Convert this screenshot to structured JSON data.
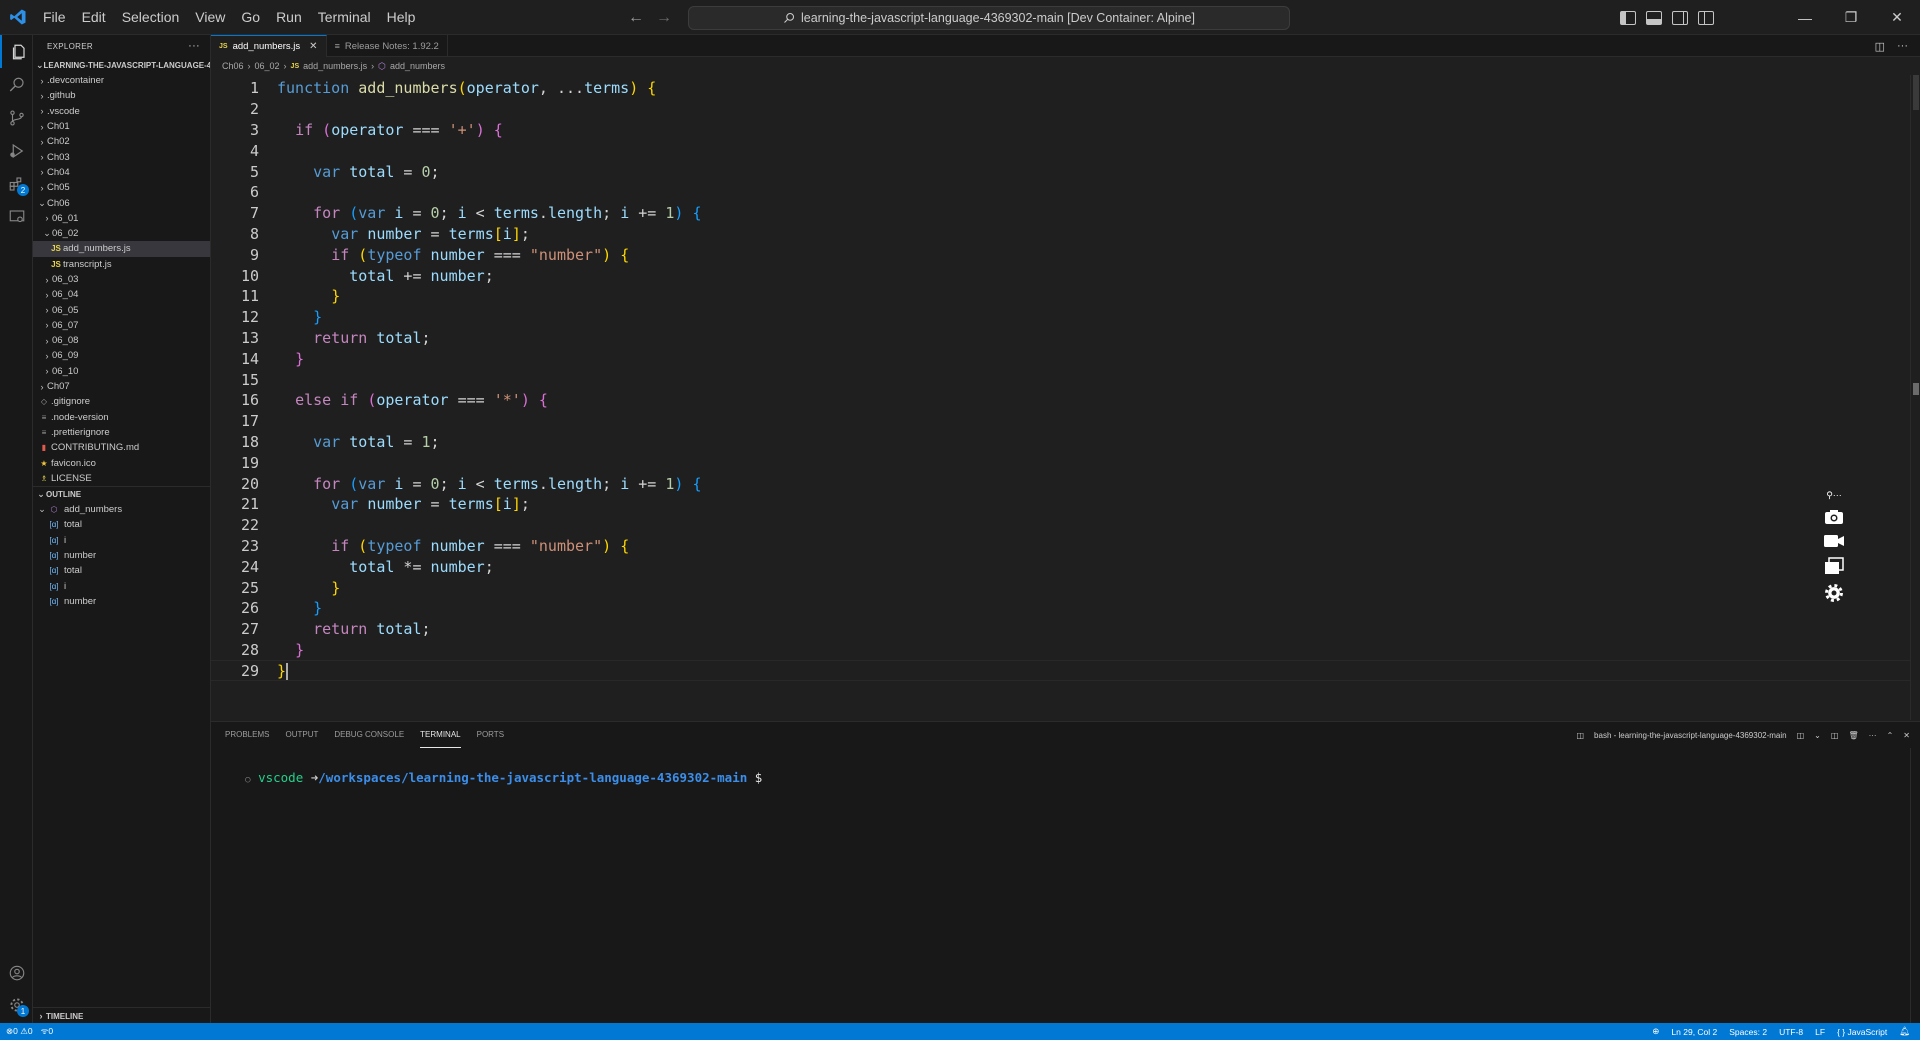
{
  "menu": [
    "File",
    "Edit",
    "Selection",
    "View",
    "Go",
    "Run",
    "Terminal",
    "Help"
  ],
  "command_center": "learning-the-javascript-language-4369302-main [Dev Container: Alpine]",
  "explorer": {
    "header": "EXPLORER",
    "root": "LEARNING-THE-JAVASCRIPT-LANGUAGE-4...",
    "items": [
      {
        "label": ".devcontainer",
        "indent": 0,
        "kind": "folder",
        "open": false
      },
      {
        "label": ".github",
        "indent": 0,
        "kind": "folder",
        "open": false
      },
      {
        "label": ".vscode",
        "indent": 0,
        "kind": "folder",
        "open": false
      },
      {
        "label": "Ch01",
        "indent": 0,
        "kind": "folder",
        "open": false
      },
      {
        "label": "Ch02",
        "indent": 0,
        "kind": "folder",
        "open": false
      },
      {
        "label": "Ch03",
        "indent": 0,
        "kind": "folder",
        "open": false
      },
      {
        "label": "Ch04",
        "indent": 0,
        "kind": "folder",
        "open": false
      },
      {
        "label": "Ch05",
        "indent": 0,
        "kind": "folder",
        "open": false
      },
      {
        "label": "Ch06",
        "indent": 0,
        "kind": "folder",
        "open": true
      },
      {
        "label": "06_01",
        "indent": 1,
        "kind": "folder",
        "open": false
      },
      {
        "label": "06_02",
        "indent": 1,
        "kind": "folder",
        "open": true
      },
      {
        "label": "add_numbers.js",
        "indent": 2,
        "kind": "js",
        "selected": true
      },
      {
        "label": "transcript.js",
        "indent": 2,
        "kind": "js"
      },
      {
        "label": "06_03",
        "indent": 1,
        "kind": "folder",
        "open": false
      },
      {
        "label": "06_04",
        "indent": 1,
        "kind": "folder",
        "open": false
      },
      {
        "label": "06_05",
        "indent": 1,
        "kind": "folder",
        "open": false
      },
      {
        "label": "06_07",
        "indent": 1,
        "kind": "folder",
        "open": false
      },
      {
        "label": "06_08",
        "indent": 1,
        "kind": "folder",
        "open": false
      },
      {
        "label": "06_09",
        "indent": 1,
        "kind": "folder",
        "open": false
      },
      {
        "label": "06_10",
        "indent": 1,
        "kind": "folder",
        "open": false
      },
      {
        "label": "Ch07",
        "indent": 0,
        "kind": "folder",
        "open": false
      },
      {
        "label": ".gitignore",
        "indent": 0,
        "kind": "git"
      },
      {
        "label": ".node-version",
        "indent": 0,
        "kind": "text"
      },
      {
        "label": ".prettierignore",
        "indent": 0,
        "kind": "text"
      },
      {
        "label": "CONTRIBUTING.md",
        "indent": 0,
        "kind": "md"
      },
      {
        "label": "favicon.ico",
        "indent": 0,
        "kind": "ico"
      },
      {
        "label": "LICENSE",
        "indent": 0,
        "kind": "license"
      }
    ]
  },
  "outline": {
    "header": "OUTLINE",
    "items": [
      {
        "label": "add_numbers",
        "kind": "function"
      },
      {
        "label": "total",
        "kind": "variable"
      },
      {
        "label": "i",
        "kind": "variable"
      },
      {
        "label": "number",
        "kind": "variable"
      },
      {
        "label": "total",
        "kind": "variable"
      },
      {
        "label": "i",
        "kind": "variable"
      },
      {
        "label": "number",
        "kind": "variable"
      }
    ]
  },
  "timeline": "TIMELINE",
  "tabs": [
    {
      "label": "add_numbers.js",
      "icon": "JS",
      "active": true
    },
    {
      "label": "Release Notes: 1.92.2",
      "icon": "≡",
      "active": false
    }
  ],
  "breadcrumbs": [
    "Ch06",
    "06_02",
    "add_numbers.js",
    "add_numbers"
  ],
  "code": [
    [
      [
        "kw",
        "function"
      ],
      [
        "def",
        " "
      ],
      [
        "fn",
        "add_numbers"
      ],
      [
        "b1",
        "("
      ],
      [
        "var",
        "operator"
      ],
      [
        "def",
        ", ..."
      ],
      [
        "var",
        "terms"
      ],
      [
        "b1",
        ")"
      ],
      [
        "def",
        " "
      ],
      [
        "b1",
        "{"
      ]
    ],
    [],
    [
      [
        "def",
        "  "
      ],
      [
        "kw2",
        "if"
      ],
      [
        "def",
        " "
      ],
      [
        "b2",
        "("
      ],
      [
        "var",
        "operator"
      ],
      [
        "def",
        " === "
      ],
      [
        "str",
        "'+'"
      ],
      [
        "b2",
        ")"
      ],
      [
        "def",
        " "
      ],
      [
        "b2",
        "{"
      ]
    ],
    [],
    [
      [
        "def",
        "    "
      ],
      [
        "kw",
        "var"
      ],
      [
        "def",
        " "
      ],
      [
        "var",
        "total"
      ],
      [
        "def",
        " = "
      ],
      [
        "num",
        "0"
      ],
      [
        "def",
        ";"
      ]
    ],
    [],
    [
      [
        "def",
        "    "
      ],
      [
        "kw2",
        "for"
      ],
      [
        "def",
        " "
      ],
      [
        "b3",
        "("
      ],
      [
        "kw",
        "var"
      ],
      [
        "def",
        " "
      ],
      [
        "var",
        "i"
      ],
      [
        "def",
        " = "
      ],
      [
        "num",
        "0"
      ],
      [
        "def",
        "; "
      ],
      [
        "var",
        "i"
      ],
      [
        "def",
        " < "
      ],
      [
        "var",
        "terms"
      ],
      [
        "def",
        "."
      ],
      [
        "var",
        "length"
      ],
      [
        "def",
        "; "
      ],
      [
        "var",
        "i"
      ],
      [
        "def",
        " += "
      ],
      [
        "num",
        "1"
      ],
      [
        "b3",
        ")"
      ],
      [
        "def",
        " "
      ],
      [
        "b3",
        "{"
      ]
    ],
    [
      [
        "def",
        "      "
      ],
      [
        "kw",
        "var"
      ],
      [
        "def",
        " "
      ],
      [
        "var",
        "number"
      ],
      [
        "def",
        " = "
      ],
      [
        "var",
        "terms"
      ],
      [
        "b1",
        "["
      ],
      [
        "var",
        "i"
      ],
      [
        "b1",
        "]"
      ],
      [
        "def",
        ";"
      ]
    ],
    [
      [
        "def",
        "      "
      ],
      [
        "kw2",
        "if"
      ],
      [
        "def",
        " "
      ],
      [
        "b1",
        "("
      ],
      [
        "kw",
        "typeof"
      ],
      [
        "def",
        " "
      ],
      [
        "var",
        "number"
      ],
      [
        "def",
        " === "
      ],
      [
        "str",
        "\"number\""
      ],
      [
        "b1",
        ")"
      ],
      [
        "def",
        " "
      ],
      [
        "b1",
        "{"
      ]
    ],
    [
      [
        "def",
        "        "
      ],
      [
        "var",
        "total"
      ],
      [
        "def",
        " += "
      ],
      [
        "var",
        "number"
      ],
      [
        "def",
        ";"
      ]
    ],
    [
      [
        "def",
        "      "
      ],
      [
        "b1",
        "}"
      ]
    ],
    [
      [
        "def",
        "    "
      ],
      [
        "b3",
        "}"
      ]
    ],
    [
      [
        "def",
        "    "
      ],
      [
        "kw2",
        "return"
      ],
      [
        "def",
        " "
      ],
      [
        "var",
        "total"
      ],
      [
        "def",
        ";"
      ]
    ],
    [
      [
        "def",
        "  "
      ],
      [
        "b2",
        "}"
      ]
    ],
    [],
    [
      [
        "def",
        "  "
      ],
      [
        "kw2",
        "else if"
      ],
      [
        "def",
        " "
      ],
      [
        "b2",
        "("
      ],
      [
        "var",
        "operator"
      ],
      [
        "def",
        " === "
      ],
      [
        "str",
        "'*'"
      ],
      [
        "b2",
        ")"
      ],
      [
        "def",
        " "
      ],
      [
        "b2",
        "{"
      ]
    ],
    [],
    [
      [
        "def",
        "    "
      ],
      [
        "kw",
        "var"
      ],
      [
        "def",
        " "
      ],
      [
        "var",
        "total"
      ],
      [
        "def",
        " = "
      ],
      [
        "num",
        "1"
      ],
      [
        "def",
        ";"
      ]
    ],
    [],
    [
      [
        "def",
        "    "
      ],
      [
        "kw2",
        "for"
      ],
      [
        "def",
        " "
      ],
      [
        "b3",
        "("
      ],
      [
        "kw",
        "var"
      ],
      [
        "def",
        " "
      ],
      [
        "var",
        "i"
      ],
      [
        "def",
        " = "
      ],
      [
        "num",
        "0"
      ],
      [
        "def",
        "; "
      ],
      [
        "var",
        "i"
      ],
      [
        "def",
        " < "
      ],
      [
        "var",
        "terms"
      ],
      [
        "def",
        "."
      ],
      [
        "var",
        "length"
      ],
      [
        "def",
        "; "
      ],
      [
        "var",
        "i"
      ],
      [
        "def",
        " += "
      ],
      [
        "num",
        "1"
      ],
      [
        "b3",
        ")"
      ],
      [
        "def",
        " "
      ],
      [
        "b3",
        "{"
      ]
    ],
    [
      [
        "def",
        "      "
      ],
      [
        "kw",
        "var"
      ],
      [
        "def",
        " "
      ],
      [
        "var",
        "number"
      ],
      [
        "def",
        " = "
      ],
      [
        "var",
        "terms"
      ],
      [
        "b1",
        "["
      ],
      [
        "var",
        "i"
      ],
      [
        "b1",
        "]"
      ],
      [
        "def",
        ";"
      ]
    ],
    [],
    [
      [
        "def",
        "      "
      ],
      [
        "kw2",
        "if"
      ],
      [
        "def",
        " "
      ],
      [
        "b1",
        "("
      ],
      [
        "kw",
        "typeof"
      ],
      [
        "def",
        " "
      ],
      [
        "var",
        "number"
      ],
      [
        "def",
        " === "
      ],
      [
        "str",
        "\"number\""
      ],
      [
        "b1",
        ")"
      ],
      [
        "def",
        " "
      ],
      [
        "b1",
        "{"
      ]
    ],
    [
      [
        "def",
        "        "
      ],
      [
        "var",
        "total"
      ],
      [
        "def",
        " *= "
      ],
      [
        "var",
        "number"
      ],
      [
        "def",
        ";"
      ]
    ],
    [
      [
        "def",
        "      "
      ],
      [
        "b1",
        "}"
      ]
    ],
    [
      [
        "def",
        "    "
      ],
      [
        "b3",
        "}"
      ]
    ],
    [
      [
        "def",
        "    "
      ],
      [
        "kw2",
        "return"
      ],
      [
        "def",
        " "
      ],
      [
        "var",
        "total"
      ],
      [
        "def",
        ";"
      ]
    ],
    [
      [
        "def",
        "  "
      ],
      [
        "b2",
        "}"
      ]
    ],
    [
      [
        "b1",
        "}"
      ]
    ]
  ],
  "current_line": 29,
  "panel": {
    "tabs": [
      "PROBLEMS",
      "OUTPUT",
      "DEBUG CONSOLE",
      "TERMINAL",
      "PORTS"
    ],
    "active_tab": "TERMINAL",
    "terminal_name": "bash - learning-the-javascript-language-4369302-main",
    "prompt_user": "vscode",
    "prompt_arrow": "➜",
    "prompt_path": "/workspaces/learning-the-javascript-language-4369302-main",
    "prompt_symbol": "$"
  },
  "status": {
    "errors": "0",
    "warnings": "0",
    "ports": "0",
    "position": "Ln 29, Col 2",
    "spaces": "Spaces: 2",
    "encoding": "UTF-8",
    "eol": "LF",
    "language": "JavaScript"
  },
  "colors": {
    "accent": "#0078d4",
    "keyword": "#569cd6",
    "control": "#c586c0",
    "function": "#dcdcaa",
    "variable": "#9cdcfe",
    "string": "#ce9178",
    "number": "#b5cea8"
  }
}
